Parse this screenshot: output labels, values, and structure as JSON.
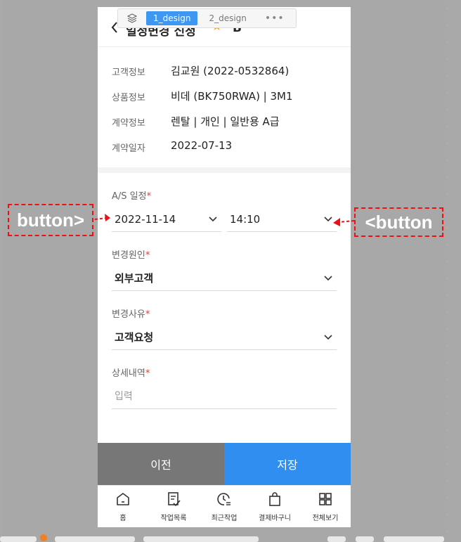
{
  "design_tabs": {
    "tabs": [
      "1_design",
      "2_design"
    ],
    "active": "1_design",
    "more": "•••"
  },
  "header": {
    "title": "일정변경 신청",
    "extra": "B"
  },
  "info": [
    {
      "label": "고객정보",
      "value": "김교원 (2022-0532864)"
    },
    {
      "label": "상품정보",
      "value": "비데 (BK750RWA) | 3M1"
    },
    {
      "label": "계약정보",
      "value": "렌탈 | 개인 | 일반용 A급"
    },
    {
      "label": "계약일자",
      "value": "2022-07-13"
    }
  ],
  "form": {
    "schedule": {
      "label": "A/S 일정",
      "required": "*",
      "date": "2022-11-14",
      "time": "14:10"
    },
    "change_cause": {
      "label": "변경원인",
      "required": "*",
      "value": "외부고객"
    },
    "change_reason": {
      "label": "변경사유",
      "required": "*",
      "value": "고객요청"
    },
    "detail": {
      "label": "상세내역",
      "required": "*",
      "placeholder": "입력"
    }
  },
  "buttons": {
    "prev": "이전",
    "save": "저장"
  },
  "bottom_nav": [
    {
      "label": "홈",
      "icon": "home-icon"
    },
    {
      "label": "작업목록",
      "icon": "task-list-icon"
    },
    {
      "label": "최근작업",
      "icon": "recent-work-icon"
    },
    {
      "label": "결제바구니",
      "icon": "shopping-bag-icon"
    },
    {
      "label": "전체보기",
      "icon": "grid-icon"
    }
  ],
  "annotations": {
    "left": "button>",
    "right": "<button"
  },
  "colors": {
    "primary": "#2f8ef0",
    "secondary": "#777777",
    "required": "#e53935",
    "annotation": "#ee1111",
    "star": "#f4a11b"
  }
}
